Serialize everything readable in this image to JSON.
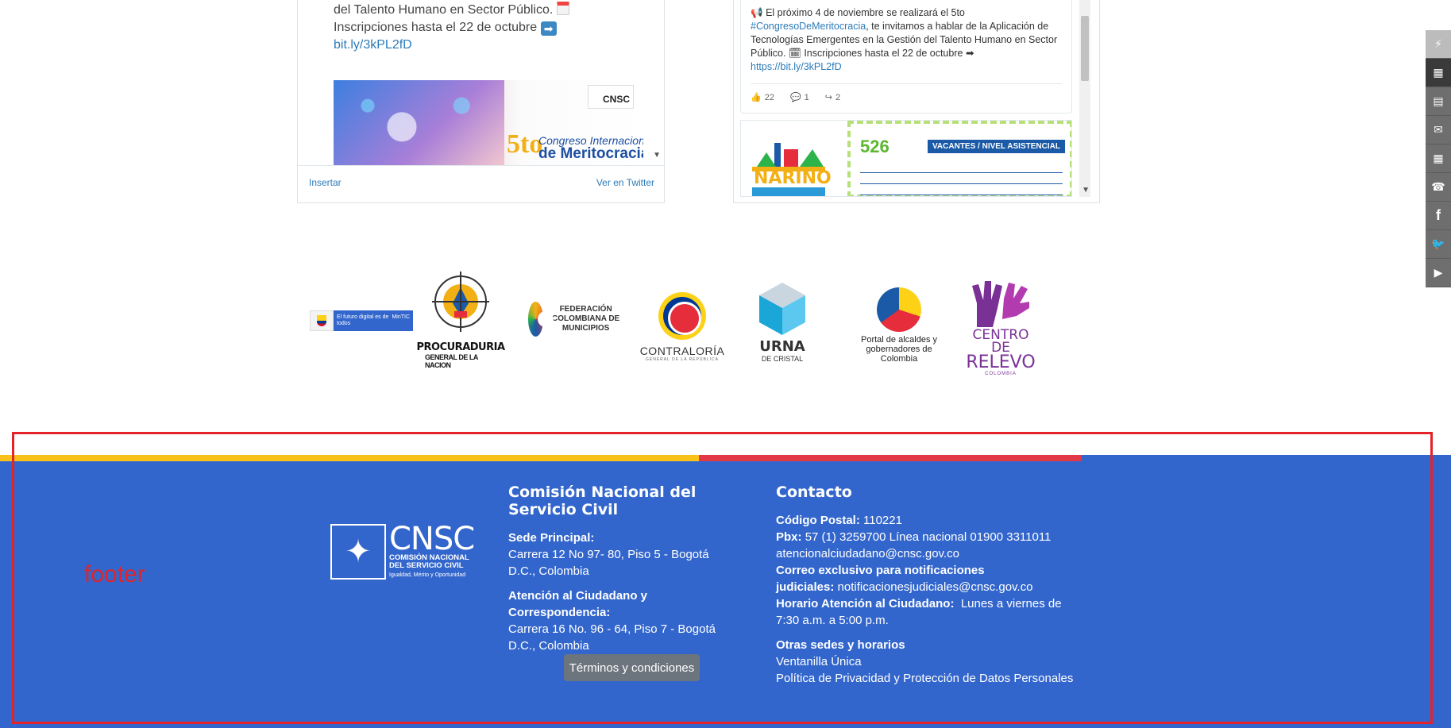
{
  "tweets": {
    "left": {
      "text_line1": "del Talento Humano en Sector Público.",
      "text_line2": "Inscripciones hasta el 22 de octubre",
      "link": "bit.ly/3kPL2fD",
      "media_org_label": "CNSC",
      "media_title_num": "5to",
      "media_title_line1": "Congreso Internacional",
      "media_title_line2": "de Meritocracia",
      "embed_label": "Insertar",
      "view_label": "Ver en Twitter"
    },
    "right": {
      "text_part1": "El próximo 4 de noviembre se realizará el 5to",
      "hashtag": "#CongresoDeMeritocracia",
      "text_part2": ", te invitamos a hablar de la Aplicación de Tecnologías Emergentes en la Gestión del Talento Humano en Sector Público.",
      "text_part3": "Inscripciones hasta el 22 de octubre",
      "link": "https://bit.ly/3kPL2fD",
      "likes": "22",
      "comments": "1",
      "retweets": "2",
      "narino_logo": "NARIÑO",
      "vacantes_num": "526",
      "vacantes_label": "VACANTES / NIVEL ASISTENCIAL"
    }
  },
  "partners": {
    "mintic_text": "El futuro digital es de todos",
    "mintic_brand": "MinTIC",
    "procuraduria_line1": "PROCURADURIA",
    "procuraduria_line2": "GENERAL DE LA NACION",
    "fcm_text": "FEDERACIÓN COLOMBIANA DE MUNICIPIOS",
    "contraloria": "CONTRALORÍA",
    "contraloria_sub": "GENERAL DE LA REPÚBLICA",
    "urna": "URNA",
    "urna_sub": "DE CRISTAL",
    "portal": "Portal de alcaldes y gobernadores de Colombia",
    "relevo_line1": "CENTRO DE",
    "relevo_line2": "RELEVO",
    "relevo_sub": "COLOMBIA"
  },
  "sidebar_icons": [
    "link-icon",
    "table-icon",
    "chat-icon",
    "mail-icon",
    "calendar-icon",
    "phone-icon",
    "facebook-icon",
    "twitter-icon",
    "youtube-icon"
  ],
  "footer": {
    "logo_big": "CNSC",
    "logo_small1": "COMISIÓN NACIONAL",
    "logo_small2": "DEL SERVICIO CIVIL",
    "logo_tag": "Igualdad, Mérito y Oportunidad",
    "col1": {
      "title": "Comisión Nacional del Servicio Civil",
      "sede_label": "Sede Principal:",
      "sede_value": "Carrera 12 No 97- 80, Piso 5 - Bogotá D.C., Colombia",
      "atencion_label": "Atención al Ciudadano y Correspondencia:",
      "atencion_value": "Carrera 16 No. 96 - 64, Piso 7 - Bogotá D.C., Colombia"
    },
    "terms_button": "Términos y condiciones",
    "col2": {
      "title": "Contacto",
      "postal_label": "Código Postal:",
      "postal_value": "110221",
      "pbx_label": "Pbx:",
      "pbx_value": "57 (1) 3259700 Línea nacional 01900 3311011",
      "email": "atencionalciudadano@cnsc.gov.co",
      "judicial_label_1": "Correo exclusivo para notificaciones",
      "judicial_label_2": "judiciales:",
      "judicial_value": "notificacionesjudiciales@cnsc.gov.co",
      "horario_label": "Horario Atención al Ciudadano:",
      "horario_value": "Lunes a viernes de 7:30 a.m. a 5:00 p.m.",
      "otras_label": "Otras sedes y horarios",
      "ventanilla": "Ventanilla Única",
      "politica": "Política de Privacidad y Protección de Datos Personales"
    }
  },
  "annotation_label": "footer",
  "colors": {
    "footer_bg": "#3366cc",
    "stripe_yellow": "#f9c11a",
    "stripe_red": "#e13a46",
    "annotation_red": "#e32328"
  }
}
